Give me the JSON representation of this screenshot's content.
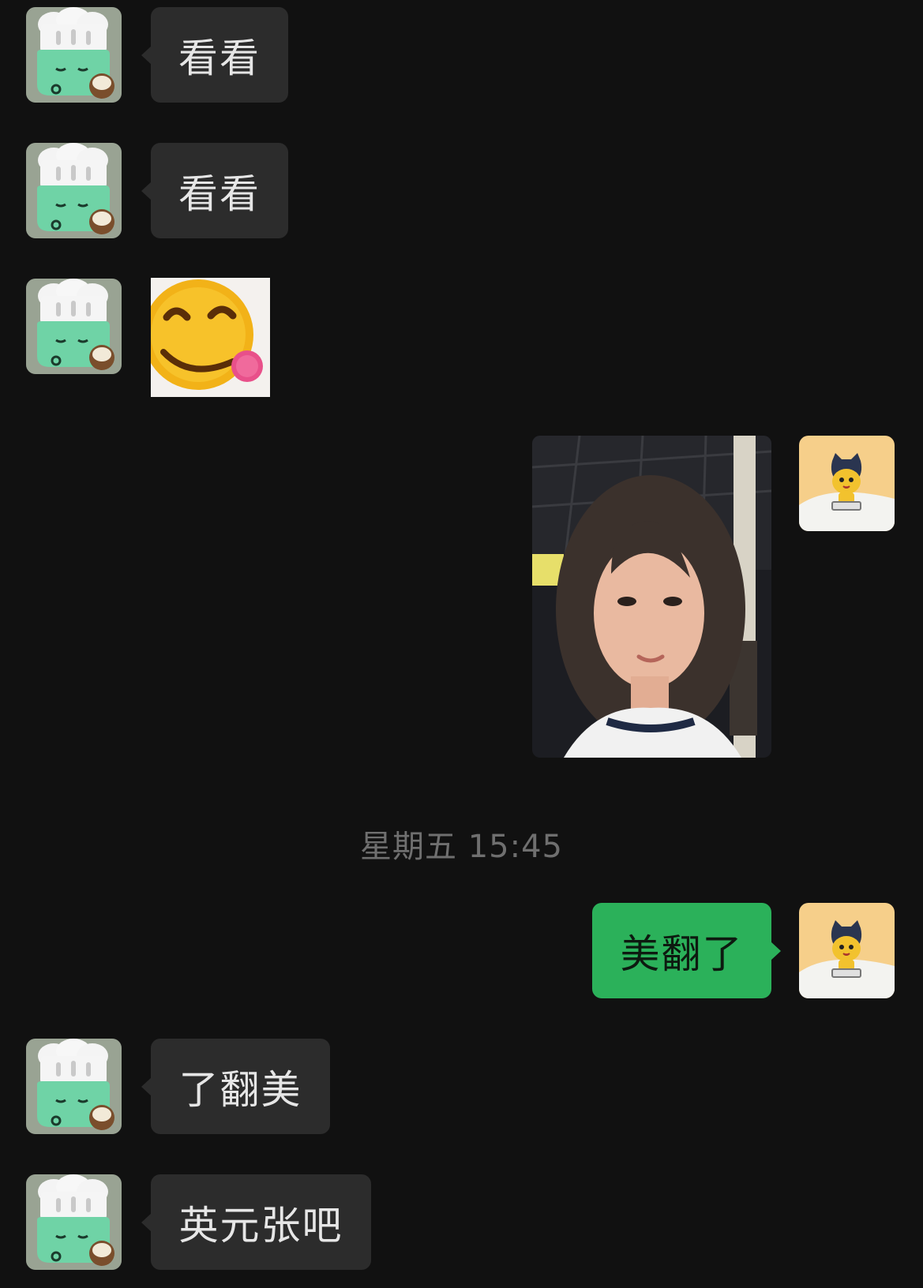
{
  "messages": [
    {
      "sender": "other",
      "type": "text",
      "text": "看看"
    },
    {
      "sender": "other",
      "type": "text",
      "text": "看看"
    },
    {
      "sender": "other",
      "type": "sticker",
      "icon": "smiling-face-sticker"
    },
    {
      "sender": "self",
      "type": "image",
      "icon": "selfie-photo"
    },
    {
      "sender": "self",
      "type": "text",
      "text": "美翻了"
    },
    {
      "sender": "other",
      "type": "text",
      "text": "了翻美"
    },
    {
      "sender": "other",
      "type": "text",
      "text": "英元张吧"
    }
  ],
  "timestamp": "星期五 15:45",
  "avatars": {
    "other": "chef-hat-cartoon-avatar",
    "self": "yellow-cartoon-avatar"
  },
  "colors": {
    "background": "#111111",
    "incoming_bubble": "#2c2c2c",
    "outgoing_bubble": "#2bb15a",
    "timestamp_text": "#6f6f6f"
  }
}
